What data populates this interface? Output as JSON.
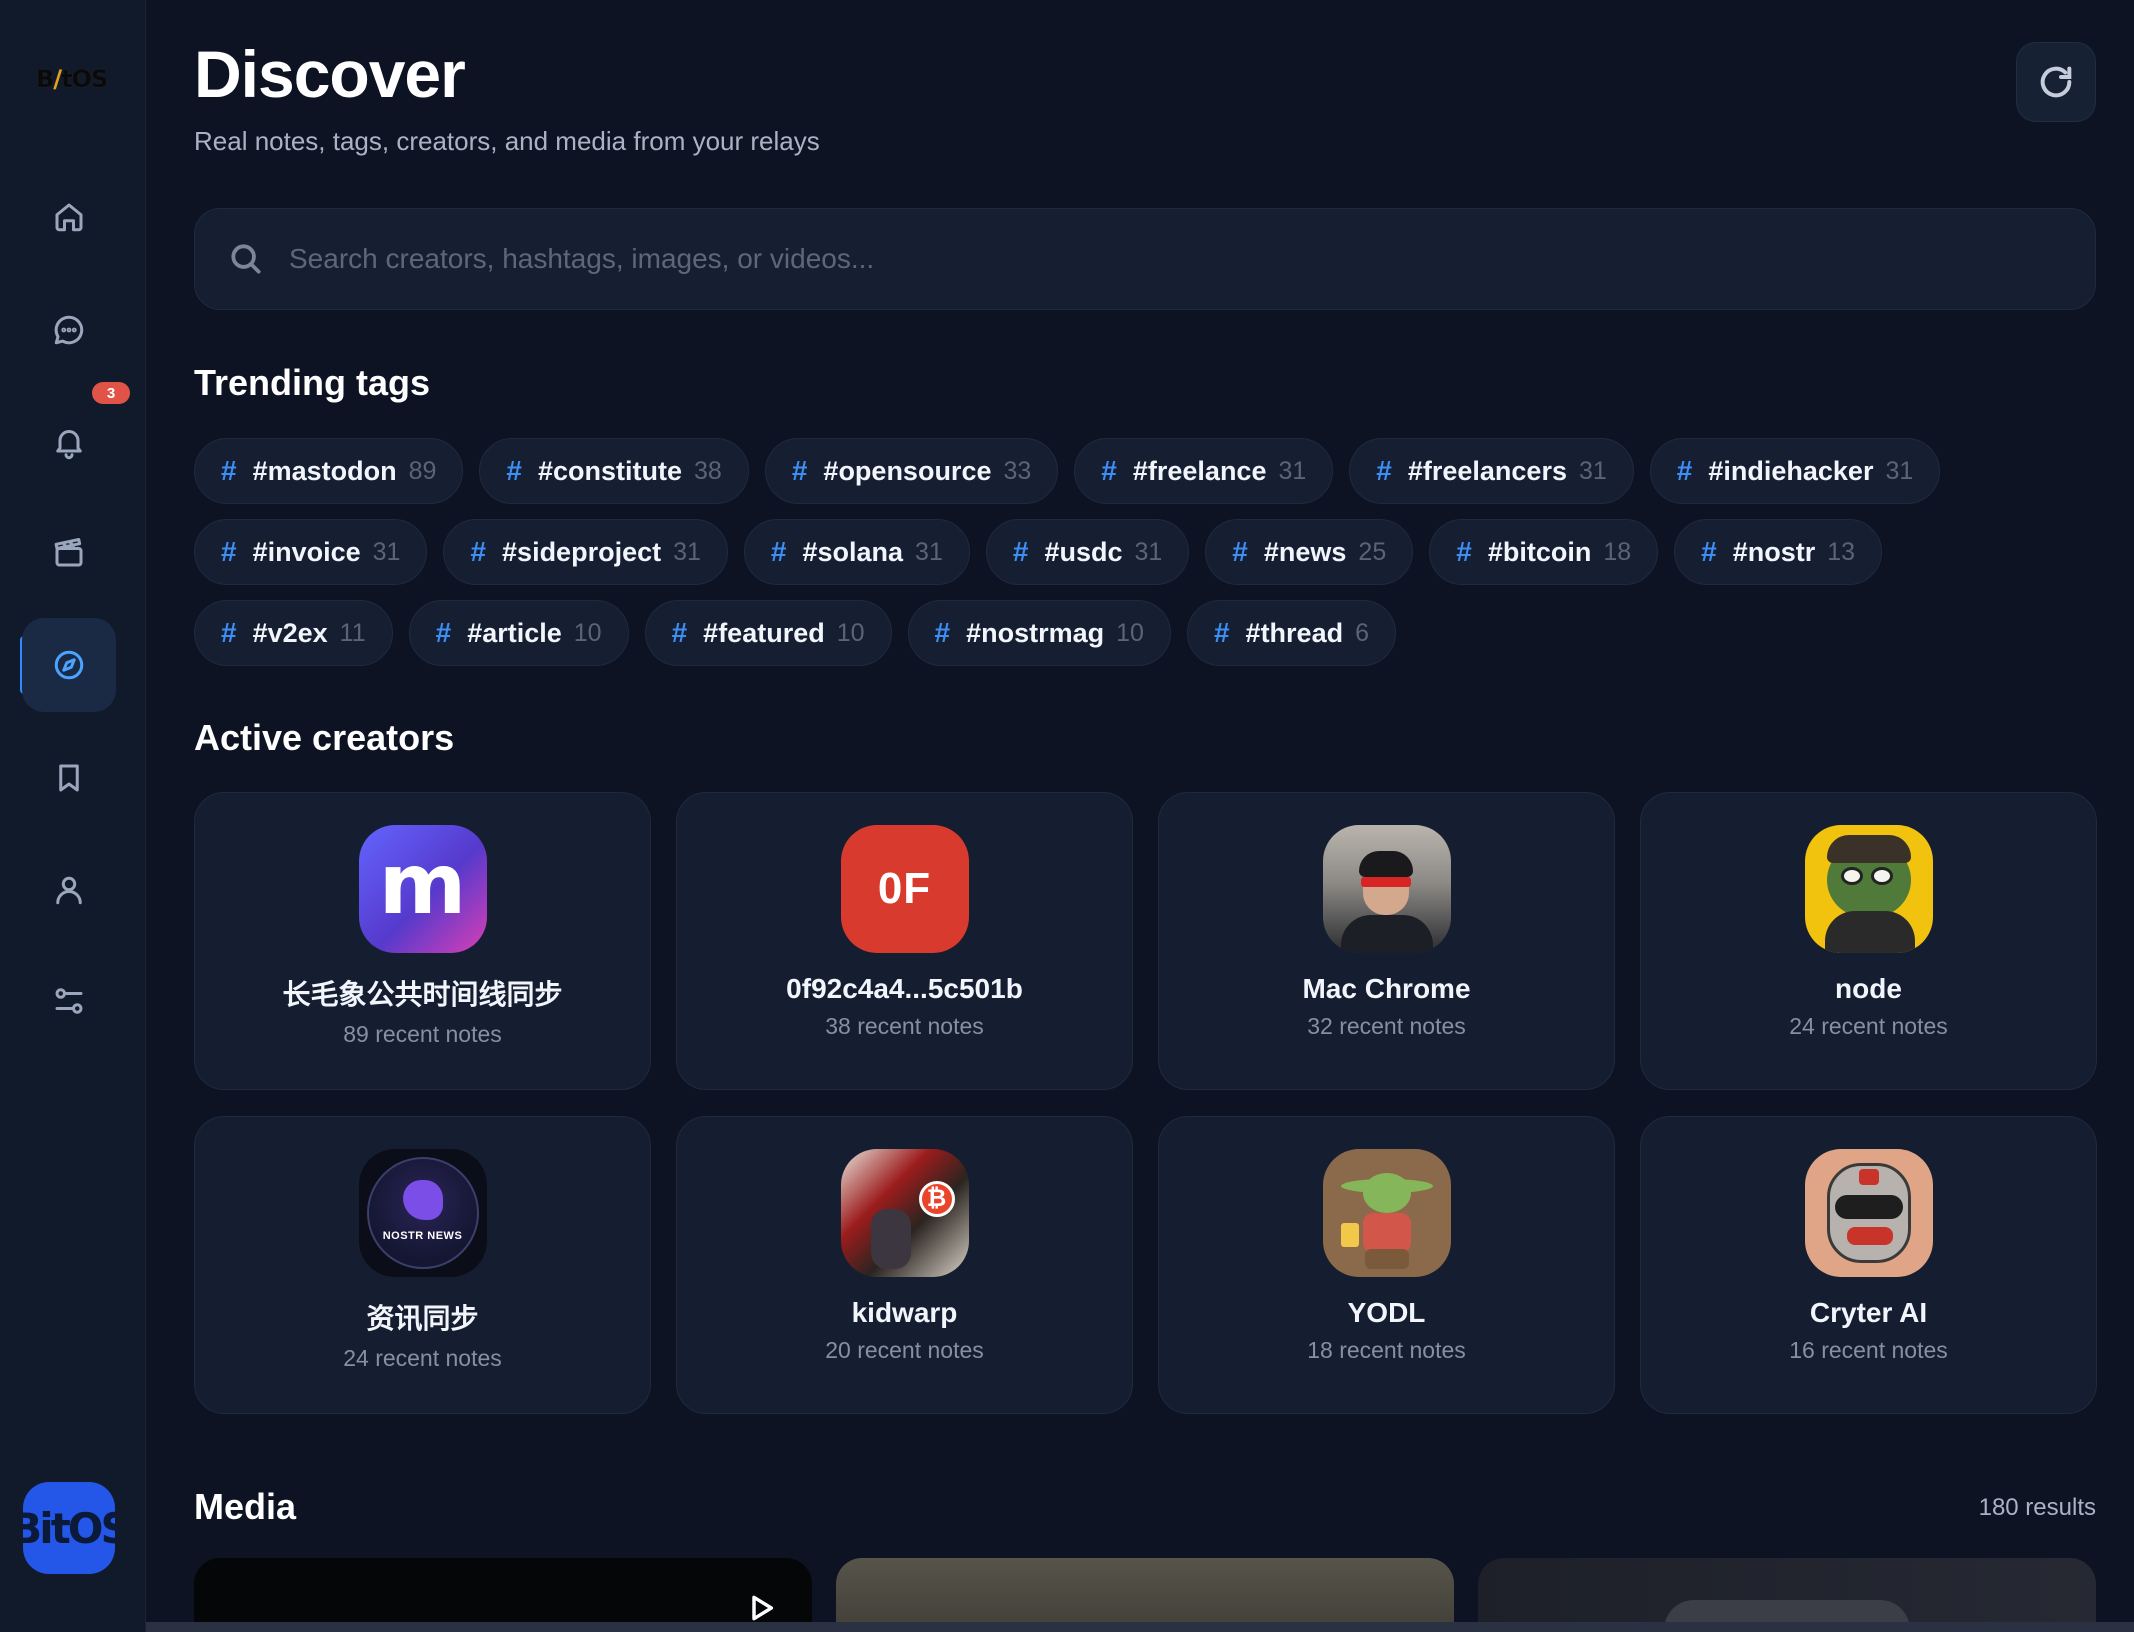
{
  "sidebar": {
    "logo_text": "BitOS",
    "notification_count": "3",
    "items": [
      {
        "name": "home",
        "icon": "home-icon"
      },
      {
        "name": "messages",
        "icon": "chat-icon"
      },
      {
        "name": "notifications",
        "icon": "bell-icon"
      },
      {
        "name": "videos",
        "icon": "clapperboard-icon"
      },
      {
        "name": "discover",
        "icon": "compass-icon",
        "active": true
      },
      {
        "name": "bookmarks",
        "icon": "bookmark-icon"
      },
      {
        "name": "profile",
        "icon": "user-icon"
      },
      {
        "name": "settings",
        "icon": "sliders-icon"
      }
    ],
    "user_avatar_text": "BitOS",
    "accent_color": "#2f8cff"
  },
  "header": {
    "title": "Discover",
    "subtitle": "Real notes, tags, creators, and media from your relays"
  },
  "search": {
    "placeholder": "Search creators, hashtags, images, or videos..."
  },
  "trending": {
    "title": "Trending tags",
    "rows": [
      [
        {
          "tag": "#mastodon",
          "count": "89"
        },
        {
          "tag": "#constitute",
          "count": "38"
        },
        {
          "tag": "#opensource",
          "count": "33"
        },
        {
          "tag": "#freelance",
          "count": "31"
        },
        {
          "tag": "#freelancers",
          "count": "31"
        },
        {
          "tag": "#indiehacker",
          "count": "31"
        }
      ],
      [
        {
          "tag": "#invoice",
          "count": "31"
        },
        {
          "tag": "#sideproject",
          "count": "31"
        },
        {
          "tag": "#solana",
          "count": "31"
        },
        {
          "tag": "#usdc",
          "count": "31"
        },
        {
          "tag": "#news",
          "count": "25"
        },
        {
          "tag": "#bitcoin",
          "count": "18"
        },
        {
          "tag": "#nostr",
          "count": "13"
        }
      ],
      [
        {
          "tag": "#v2ex",
          "count": "11"
        },
        {
          "tag": "#article",
          "count": "10"
        },
        {
          "tag": "#featured",
          "count": "10"
        },
        {
          "tag": "#nostrmag",
          "count": "10"
        },
        {
          "tag": "#thread",
          "count": "6"
        }
      ]
    ]
  },
  "creators": {
    "title": "Active creators",
    "items": [
      {
        "name": "长毛象公共时间线同步",
        "notes": "89 recent notes",
        "avatar": "mastodon-logo",
        "avatar_text": "m"
      },
      {
        "name": "0f92c4a4...5c501b",
        "notes": "38 recent notes",
        "avatar": "initials",
        "avatar_text": "0F"
      },
      {
        "name": "Mac Chrome",
        "notes": "32 recent notes",
        "avatar": "photo-person"
      },
      {
        "name": "node",
        "notes": "24 recent notes",
        "avatar": "pepe-frog"
      },
      {
        "name": "资讯同步",
        "notes": "24 recent notes",
        "avatar": "nostr-news-logo",
        "avatar_text": "NOSTR NEWS"
      },
      {
        "name": "kidwarp",
        "notes": "20 recent notes",
        "avatar": "bitcoin-art"
      },
      {
        "name": "YODL",
        "notes": "18 recent notes",
        "avatar": "yoda-cartoon"
      },
      {
        "name": "Cryter AI",
        "notes": "16 recent notes",
        "avatar": "robot-cartoon"
      }
    ]
  },
  "media": {
    "title": "Media",
    "results": "180 results"
  }
}
